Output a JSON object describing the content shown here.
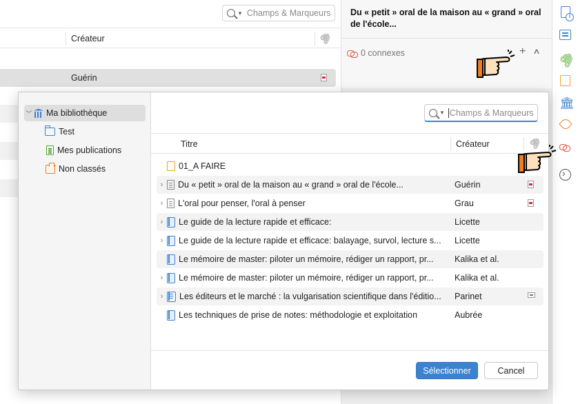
{
  "background": {
    "search_placeholder": "Champs & Marqueurs",
    "columns": {
      "creator": "Créateur"
    },
    "selected_row": {
      "creator": "Guérin"
    },
    "item_pane": {
      "title": "Du « petit » oral de la maison au « grand » oral de l'école...",
      "related": {
        "count_label": "0 connexes",
        "add_label": "+",
        "collapse_label": "^"
      }
    },
    "side_nav": {
      "icons": [
        "info-icon",
        "abstract-icon",
        "attachments-icon",
        "notes-icon",
        "libraries-collections-icon",
        "tags-icon",
        "related-icon",
        "locate-icon"
      ]
    }
  },
  "dialog": {
    "collections": [
      {
        "label": "Ma bibliothèque",
        "icon": "library-icon",
        "selected": true,
        "expanded": true
      },
      {
        "label": "Test",
        "icon": "folder-icon"
      },
      {
        "label": "Mes publications",
        "icon": "publications-icon"
      },
      {
        "label": "Non classés",
        "icon": "unfiled-icon"
      }
    ],
    "search": {
      "placeholder": "Champs & Marqueurs"
    },
    "columns": {
      "title": "Titre",
      "creator": "Créateur"
    },
    "rows": [
      {
        "title": "01_A FAIRE",
        "creator": "",
        "type": "note",
        "twisty": "",
        "attachment": ""
      },
      {
        "title": "Du « petit » oral de la maison au « grand » oral de l'école...",
        "creator": "Guérin",
        "type": "document",
        "twisty": "›",
        "attachment": "pdf"
      },
      {
        "title": "L'oral pour penser, l'oral à penser",
        "creator": "Grau",
        "type": "document",
        "twisty": "›",
        "attachment": "pdf"
      },
      {
        "title": "Le guide de la lecture rapide et efficace:",
        "creator": "Licette",
        "type": "book",
        "twisty": "›",
        "attachment": ""
      },
      {
        "title": "Le guide de la lecture rapide et efficace: balayage, survol, lecture s...",
        "creator": "Licette",
        "type": "book",
        "twisty": "›",
        "attachment": ""
      },
      {
        "title": "Le mémoire de master: piloter un mémoire, rédiger un rapport, pr...",
        "creator": "Kalika et al.",
        "type": "book",
        "twisty": "",
        "attachment": ""
      },
      {
        "title": "Le mémoire de master: piloter un mémoire, rédiger un rapport, pr...",
        "creator": "Kalika et al.",
        "type": "book",
        "twisty": "›",
        "attachment": ""
      },
      {
        "title": "Les éditeurs et le marché : la vulgarisation scientifique dans l'éditio...",
        "creator": "Parinet",
        "type": "book-section",
        "twisty": "›",
        "attachment": "snapshot"
      },
      {
        "title": "Les techniques de prise de notes: méthodologie et exploitation",
        "creator": "Aubrée",
        "type": "book",
        "twisty": "",
        "attachment": ""
      }
    ],
    "buttons": {
      "select": "Sélectionner",
      "cancel": "Cancel"
    }
  },
  "colors": {
    "accent": "#3b82d0",
    "related_icon": "#e0583c",
    "note": "#f0a31a",
    "publications": "#53a82f",
    "unfiled": "#f07e22"
  }
}
